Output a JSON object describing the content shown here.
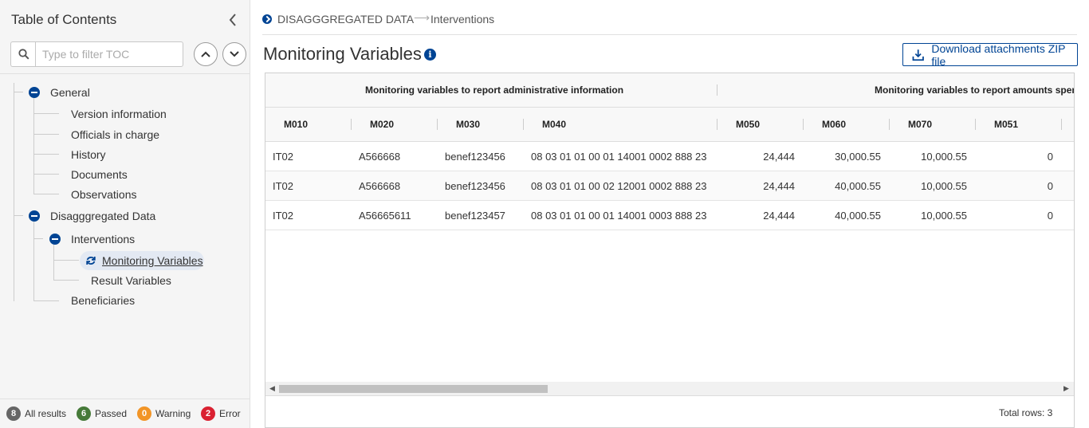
{
  "sidebar": {
    "title": "Table of Contents",
    "search_placeholder": "Type to filter TOC",
    "tree": {
      "general": "General",
      "version_information": "Version information",
      "officials_in_charge": "Officials in charge",
      "history": "History",
      "documents": "Documents",
      "observations": "Observations",
      "disaggregated_data": "Disagggregated Data",
      "interventions": "Interventions",
      "monitoring_variables": "Monitoring Variables",
      "result_variables": "Result Variables",
      "beneficiaries": "Beneficiaries"
    },
    "status": {
      "all": {
        "count": "8",
        "label": "All results",
        "color": "#666666"
      },
      "passed": {
        "count": "6",
        "label": "Passed",
        "color": "#467a39"
      },
      "warning": {
        "count": "0",
        "label": "Warning",
        "color": "#f29527"
      },
      "error": {
        "count": "2",
        "label": "Error",
        "color": "#da2131"
      }
    }
  },
  "breadcrumb": {
    "root": "DISAGGGREGATED DATA",
    "current": "Interventions"
  },
  "page": {
    "title": "Monitoring Variables",
    "download_label": "Download attachments ZIP file"
  },
  "grid": {
    "groups": [
      "Monitoring variables to report administrative information",
      "Monitoring variables to report amounts spent"
    ],
    "columns": [
      "M010",
      "M020",
      "M030",
      "M040",
      "M050",
      "M060",
      "M070",
      "M051"
    ],
    "rows": [
      [
        "IT02",
        "A566668",
        "benef123456",
        "08 03 01 01 00 01 14001 0002 888 23",
        "24,444",
        "30,000.55",
        "10,000.55",
        "0"
      ],
      [
        "IT02",
        "A566668",
        "benef123456",
        "08 03 01 01 00 02 12001 0002 888 23",
        "24,444",
        "40,000.55",
        "10,000.55",
        "0"
      ],
      [
        "IT02",
        "A56665611",
        "benef123457",
        "08 03 01 01 00 01 14001 0003 888 23",
        "24,444",
        "40,000.55",
        "10,000.55",
        "0"
      ]
    ],
    "total_rows": "Total rows: 3"
  }
}
